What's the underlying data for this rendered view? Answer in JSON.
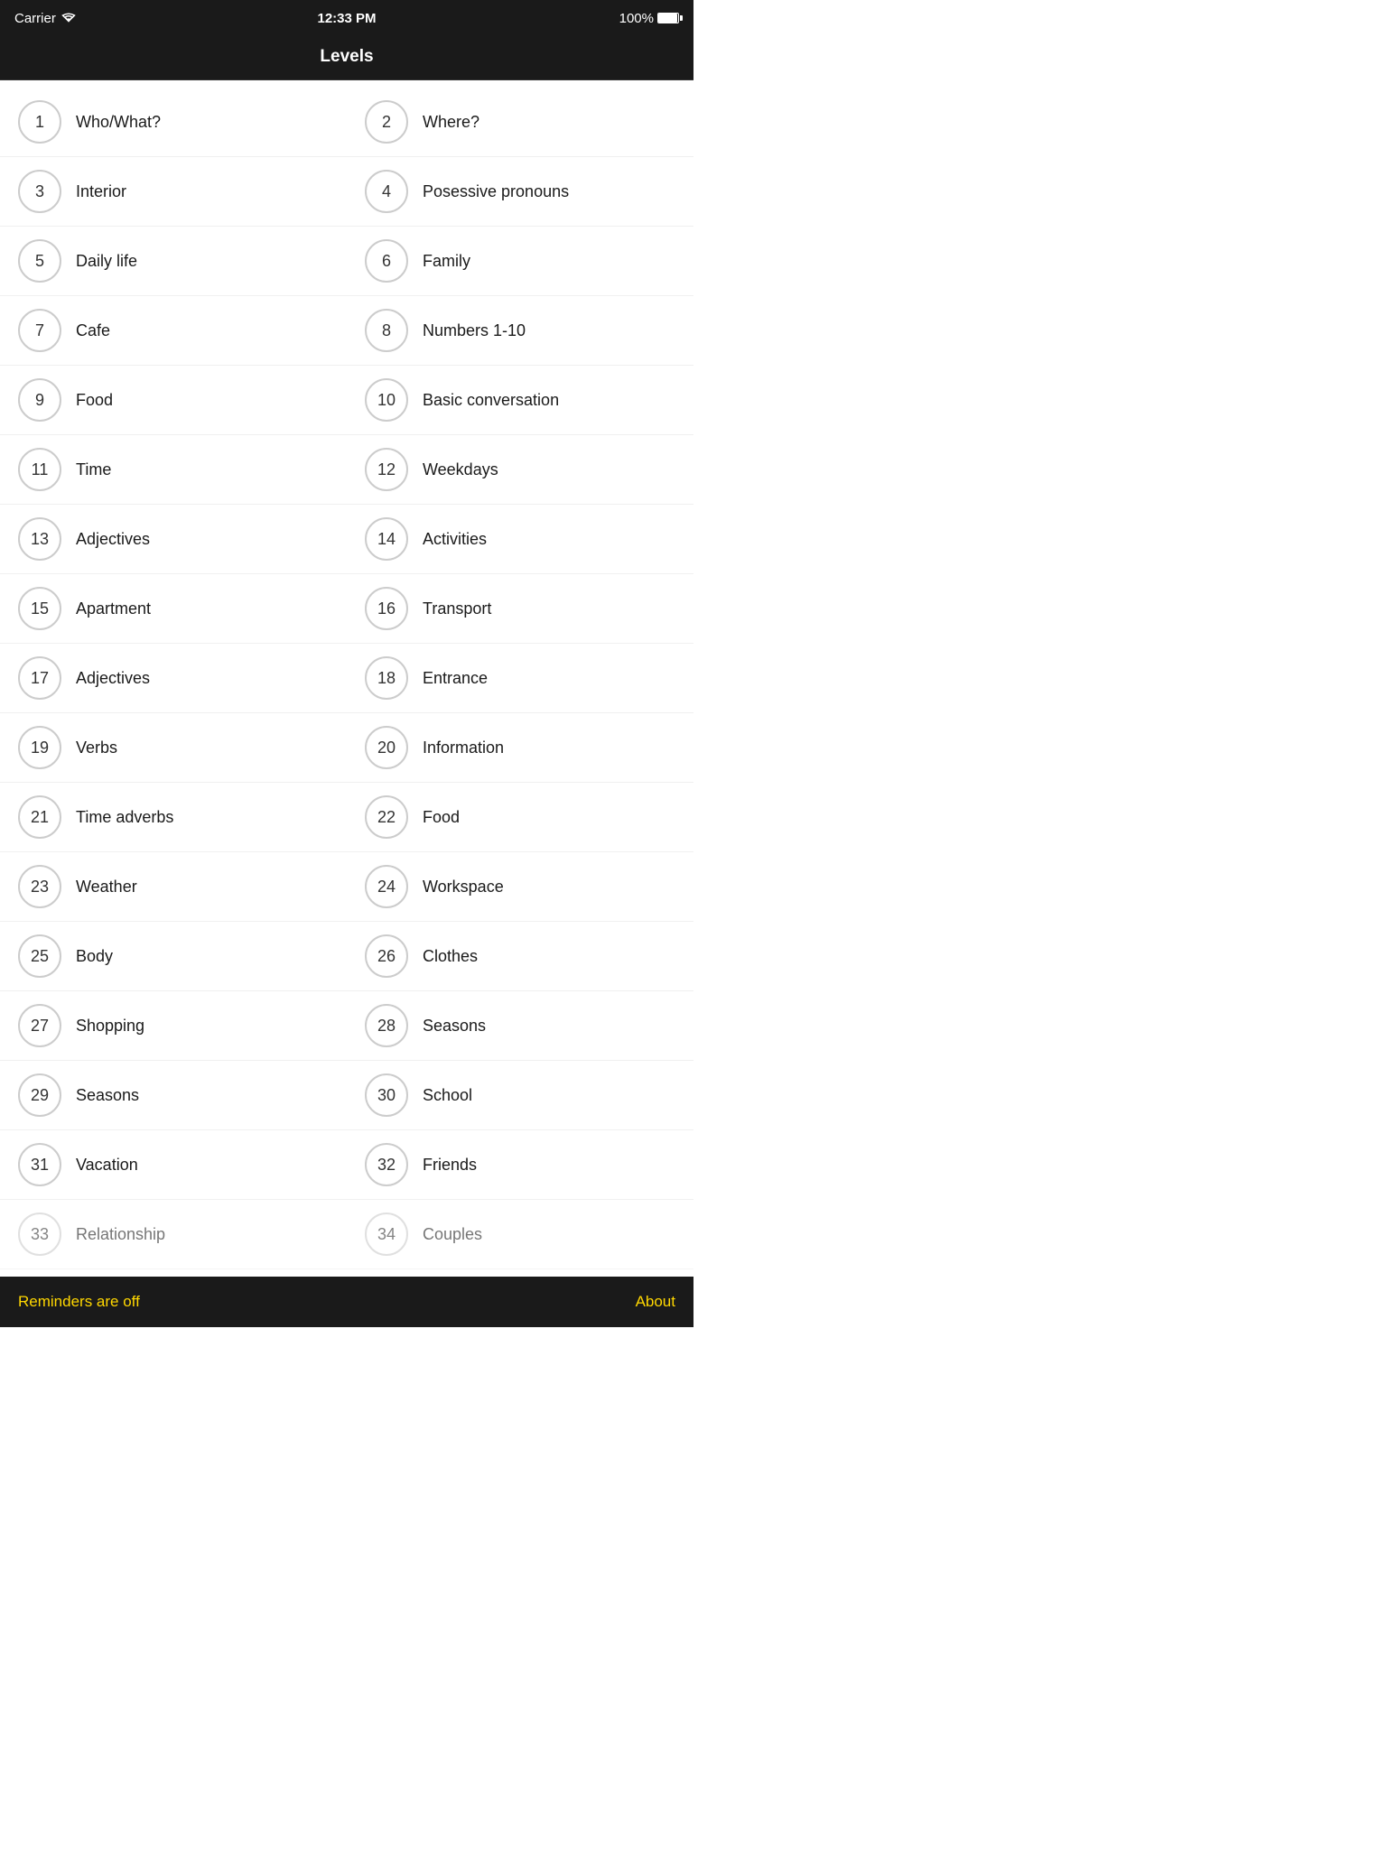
{
  "statusBar": {
    "carrier": "Carrier",
    "wifi": true,
    "time": "12:33 PM",
    "battery": "100%"
  },
  "header": {
    "title": "Levels"
  },
  "levels": [
    {
      "number": 1,
      "name": "Who/What?"
    },
    {
      "number": 2,
      "name": "Where?"
    },
    {
      "number": 3,
      "name": "Interior"
    },
    {
      "number": 4,
      "name": "Posessive pronouns"
    },
    {
      "number": 5,
      "name": "Daily life"
    },
    {
      "number": 6,
      "name": "Family"
    },
    {
      "number": 7,
      "name": "Cafe"
    },
    {
      "number": 8,
      "name": "Numbers 1-10"
    },
    {
      "number": 9,
      "name": "Food"
    },
    {
      "number": 10,
      "name": "Basic conversation"
    },
    {
      "number": 11,
      "name": "Time"
    },
    {
      "number": 12,
      "name": "Weekdays"
    },
    {
      "number": 13,
      "name": "Adjectives"
    },
    {
      "number": 14,
      "name": "Activities"
    },
    {
      "number": 15,
      "name": "Apartment"
    },
    {
      "number": 16,
      "name": "Transport"
    },
    {
      "number": 17,
      "name": "Adjectives"
    },
    {
      "number": 18,
      "name": "Entrance"
    },
    {
      "number": 19,
      "name": "Verbs"
    },
    {
      "number": 20,
      "name": "Information"
    },
    {
      "number": 21,
      "name": "Time adverbs"
    },
    {
      "number": 22,
      "name": "Food"
    },
    {
      "number": 23,
      "name": "Weather"
    },
    {
      "number": 24,
      "name": "Workspace"
    },
    {
      "number": 25,
      "name": "Body"
    },
    {
      "number": 26,
      "name": "Clothes"
    },
    {
      "number": 27,
      "name": "Shopping"
    },
    {
      "number": 28,
      "name": "Seasons"
    },
    {
      "number": 29,
      "name": "Seasons"
    },
    {
      "number": 30,
      "name": "School"
    },
    {
      "number": 31,
      "name": "Vacation"
    },
    {
      "number": 32,
      "name": "Friends"
    },
    {
      "number": 33,
      "name": "Relationship"
    },
    {
      "number": 34,
      "name": "Couples"
    }
  ],
  "bottomBar": {
    "reminders": "Reminders are off",
    "about": "About"
  }
}
